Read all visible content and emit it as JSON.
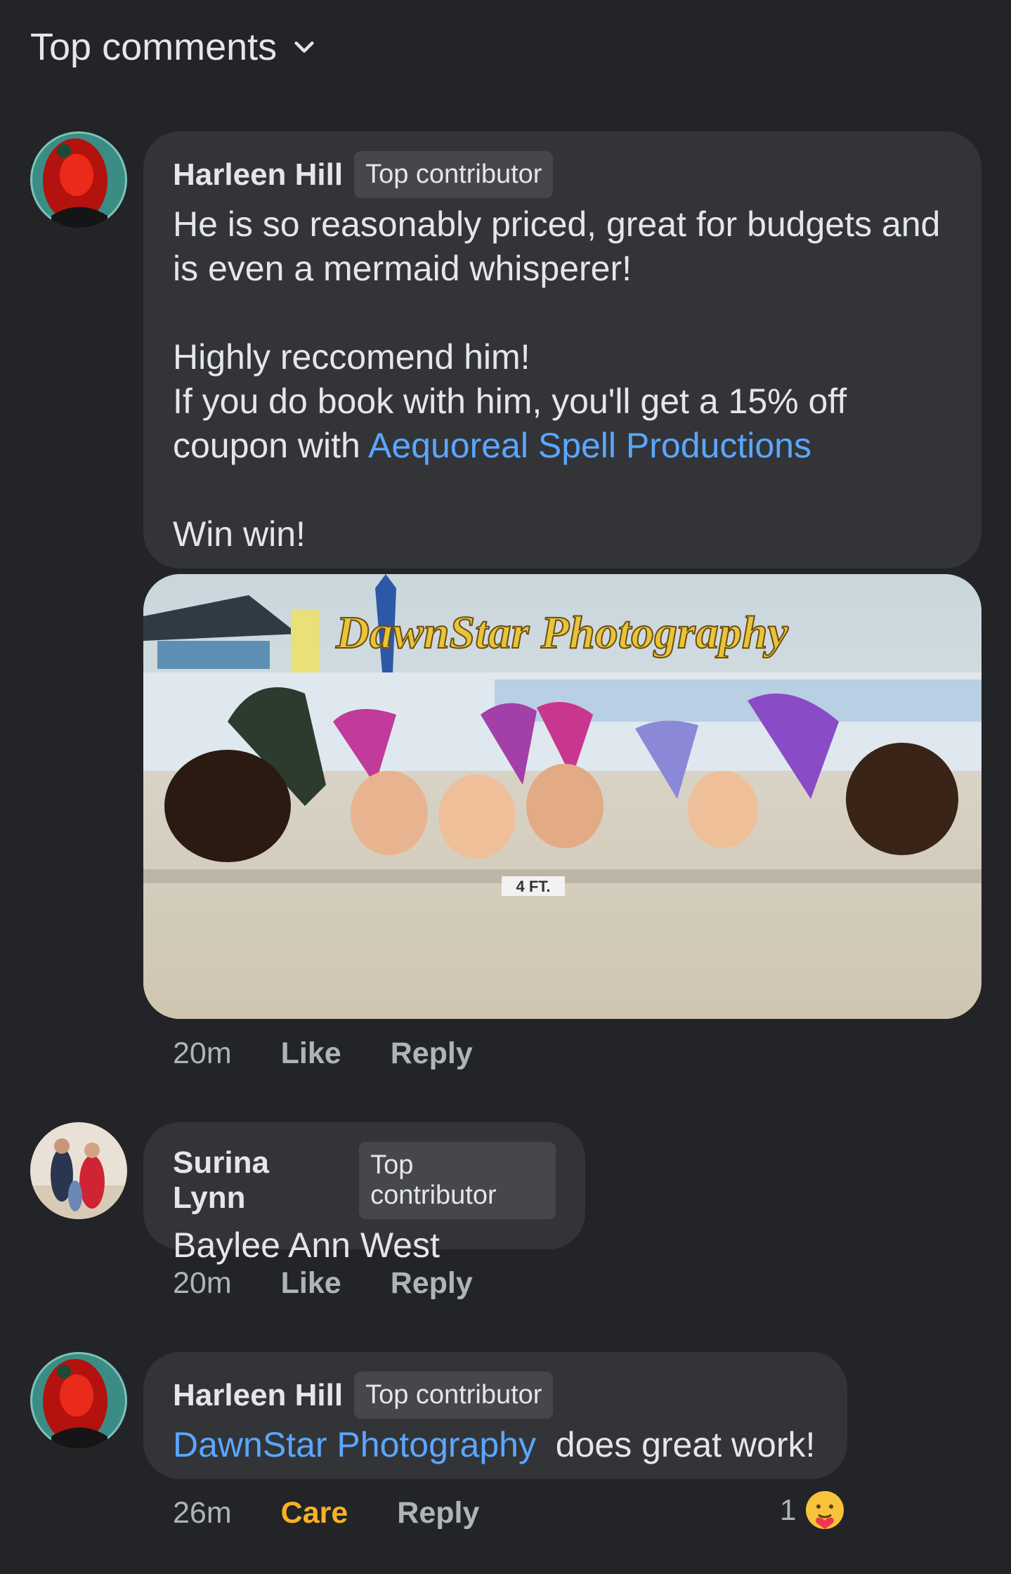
{
  "header": {
    "title": "Top comments"
  },
  "comments": [
    {
      "author": "Harleen Hill",
      "badge": "Top contributor",
      "line1": "He is so reasonably priced, great for budgets and",
      "line2": "is even a mermaid whisperer!",
      "line3": "Highly reccomend him!",
      "line4": "If you do book with him, you'll get a 15% off",
      "line5_prefix": "coupon with",
      "line5_link": "Aequoreal Spell Productions",
      "line6": "Win win!",
      "photo_watermark": "DawnStar Photography",
      "photo_sign": "4 FT.",
      "time": "20m",
      "like": "Like",
      "reply": "Reply"
    },
    {
      "author": "Surina Lynn",
      "badge": "Top contributor",
      "text": "Baylee Ann West",
      "time": "20m",
      "like": "Like",
      "reply": "Reply"
    },
    {
      "author": "Harleen Hill",
      "badge": "Top contributor",
      "link": "DawnStar Photography",
      "text": "does great work!",
      "time": "26m",
      "reaction_label": "Care",
      "reply": "Reply",
      "reaction_count": "1"
    }
  ],
  "colors": {
    "background": "#232427",
    "bubble": "#333438",
    "link": "#5aa7ff",
    "care": "#f7b125"
  }
}
